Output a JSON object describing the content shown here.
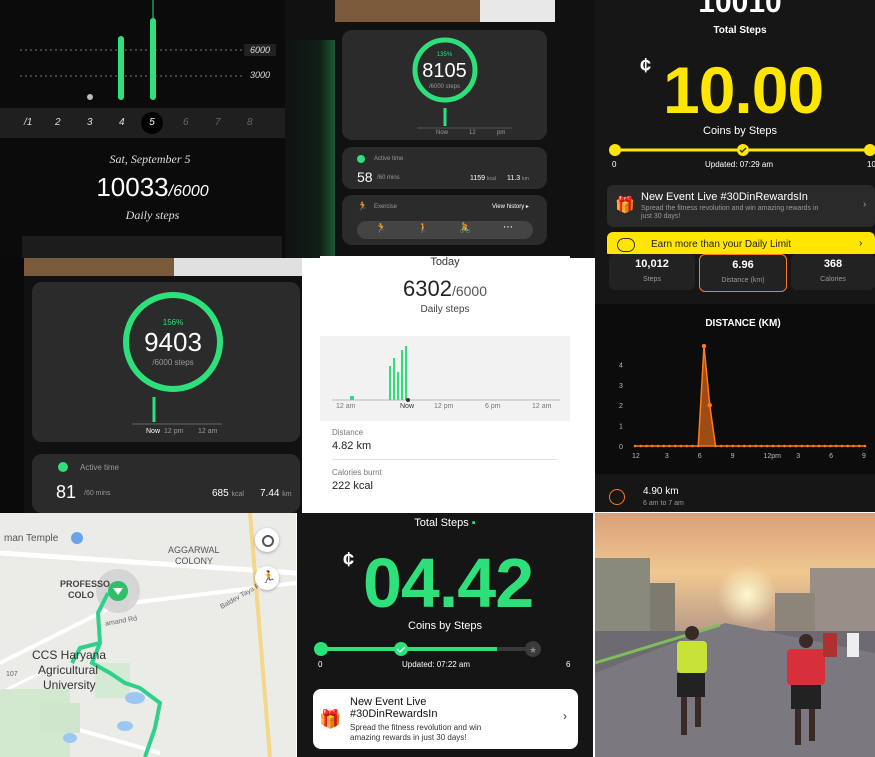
{
  "p1": {
    "grid_labels": [
      "6000",
      "3000"
    ],
    "days": [
      "/1",
      "2",
      "3",
      "4",
      "5",
      "6",
      "7",
      "8"
    ],
    "date": "Sat, September 5",
    "steps": "10033",
    "goal": "/6000",
    "caption": "Daily steps"
  },
  "p2": {
    "percent": "135%",
    "steps": "8105",
    "goal": "/6000 steps",
    "now_label": "Now",
    "t12": "12",
    "tpm": "pm",
    "active_label": "Active time",
    "active_value": "58",
    "active_unit": "/60 mins",
    "kcal": "1159",
    "kcal_unit": "kcal",
    "km": "11.3",
    "km_unit": "km",
    "exercise_label": "Exercise",
    "view_history": "View history"
  },
  "p3": {
    "top_number": "10010",
    "total_steps_label": "Total Steps",
    "coins": "10.00",
    "coins_label": "Coins by Steps",
    "min": "0",
    "updated": "Updated: 07:29 am",
    "max": "10",
    "event_title": "New Event Live #30DinRewardsIn",
    "event_sub": "Spread the fitness revolution and win amazing rewards in just 30 days!",
    "earn_more": "Earn more than your Daily Limit"
  },
  "p4": {
    "percent": "156%",
    "steps": "9403",
    "goal": "/6000 steps",
    "now_label": "Now",
    "t12pm": "12 pm",
    "t12am": "12 am",
    "active_label": "Active time",
    "active_value": "81",
    "active_unit": "/60 mins",
    "kcal": "685",
    "kcal_unit": "kcal",
    "km": "7.44",
    "km_unit": "km"
  },
  "p5": {
    "today": "Today",
    "steps": "6302",
    "goal": "/6000",
    "caption": "Daily steps",
    "axis": [
      "12 am",
      "Now",
      "12 pm",
      "6 pm",
      "12 am"
    ],
    "distance_label": "Distance",
    "distance_value": "4.82 km",
    "calories_label": "Calories burnt",
    "calories_value": "222 kcal"
  },
  "p6": {
    "stats": [
      {
        "value": "10,012",
        "label": "Steps"
      },
      {
        "value": "6.96",
        "label": "Distance (km)"
      },
      {
        "value": "368",
        "label": "Calories"
      }
    ],
    "chart_title": "DISTANCE (KM)",
    "bottom_value": "4.90 km",
    "bottom_sub": "6 am to 7 am",
    "accent": "#ff7a1a"
  },
  "chart_data": {
    "type": "area",
    "title": "DISTANCE (KM)",
    "categories": [
      "12",
      "3",
      "6",
      "9",
      "12pm",
      "3",
      "6",
      "9"
    ],
    "series": [
      {
        "values": [
          0,
          0,
          0,
          0,
          0,
          0,
          0,
          0,
          0,
          0,
          0,
          0,
          4.9,
          2.0,
          0,
          0,
          0,
          0,
          0,
          0,
          0,
          0,
          0,
          0,
          0,
          0,
          0,
          0,
          0,
          0,
          0,
          0,
          0,
          0,
          0,
          0,
          0,
          0,
          0,
          0,
          0
        ]
      }
    ],
    "y_ticks": [
      "0",
      "1",
      "2",
      "3",
      "4"
    ],
    "ylim": [
      0,
      5
    ]
  },
  "p7": {
    "labels": {
      "temple": "man Temple",
      "aggarwal1": "AGGARWAL",
      "aggarwal2": "COLONY",
      "professor1": "PROFESSO",
      "professor2": "COLO",
      "ccs1": "CCS Haryana",
      "ccs2": "Agricultural",
      "ccs3": "University",
      "baldev": "Baldev Taya R",
      "road1": "amand Rd",
      "r107": "107"
    }
  },
  "p8": {
    "title": "Total Steps",
    "coins": "04.42",
    "coins_label": "Coins by Steps",
    "min": "0",
    "updated": "Updated: 07:22 am",
    "max": "6",
    "event_title1": "New Event Live",
    "event_title2": "#30DinRewardsIn",
    "event_sub1": "Spread the fitness revolution and win",
    "event_sub2": "amazing rewards in just 30 days!"
  },
  "colors": {
    "green": "#2ee07a",
    "yellow": "#ffe600",
    "orange": "#ff7a1a"
  }
}
